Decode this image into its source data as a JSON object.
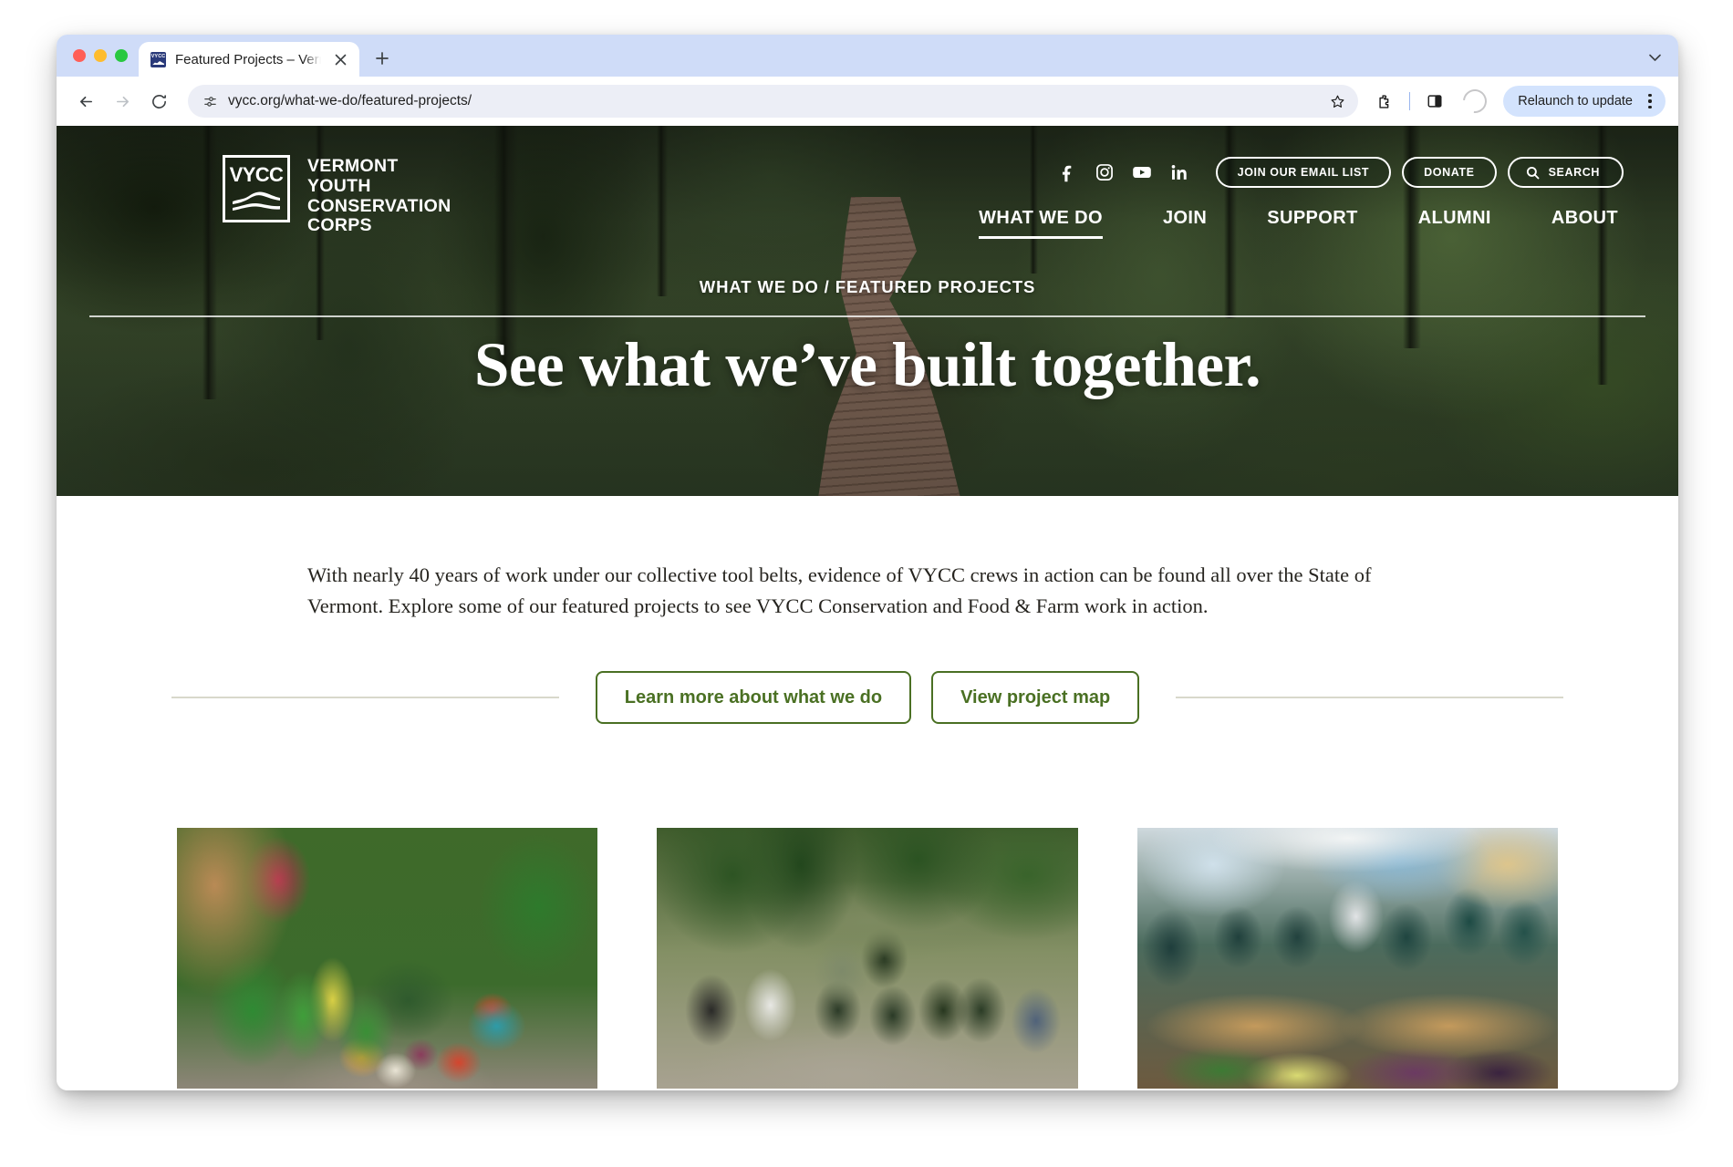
{
  "browser": {
    "tab": {
      "title": "Featured Projects – Vermont Youth Conservation Corps",
      "favicon_name": "vycc-favicon",
      "close_label": "×"
    },
    "new_tab_label": "+",
    "toolbar": {
      "back_label": "←",
      "forward_label": "→",
      "reload_label": "⟳",
      "url": "vycc.org/what-we-do/featured-projects/",
      "site_info_icon": "page-settings-icon",
      "bookmark_icon": "star-icon",
      "extensions_icon": "puzzle-icon",
      "side_panel_icon": "split-panel-icon",
      "profile_icon": "profile-avatar-icon",
      "relaunch_label": "Relaunch to update",
      "menu_icon": "kebab-menu-icon"
    }
  },
  "site": {
    "logo": {
      "mark_text": "VYCC",
      "words": "VERMONT\nYOUTH\nCONSERVATION\nCORPS",
      "word_lines": [
        "VERMONT",
        "YOUTH",
        "CONSERVATION",
        "CORPS"
      ]
    },
    "social": [
      {
        "name": "facebook-icon",
        "label": "f"
      },
      {
        "name": "instagram-icon",
        "label": ""
      },
      {
        "name": "youtube-icon",
        "label": ""
      },
      {
        "name": "linkedin-icon",
        "label": "in"
      }
    ],
    "utility_buttons": [
      {
        "label": "JOIN OUR EMAIL LIST",
        "name": "join-email-list-button"
      },
      {
        "label": "DONATE",
        "name": "donate-button"
      },
      {
        "label": "SEARCH",
        "name": "search-button"
      }
    ],
    "nav": [
      {
        "label": "WHAT WE DO",
        "active": true
      },
      {
        "label": "JOIN",
        "active": false
      },
      {
        "label": "SUPPORT",
        "active": false
      },
      {
        "label": "ALUMNI",
        "active": false
      },
      {
        "label": "ABOUT",
        "active": false
      }
    ],
    "hero": {
      "breadcrumb": "WHAT WE DO / FEATURED PROJECTS",
      "title": "See what we’ve built together.",
      "background": "forest boardwalk trail photo"
    },
    "intro": {
      "paragraph": "With nearly 40 years of work under our collective tool belts, evidence of VYCC crews in action can be found all over the State of Vermont. Explore some of our featured projects to see VYCC Conservation and Food & Farm work in action."
    },
    "cta_buttons": [
      {
        "label": "Learn more about what we do",
        "name": "learn-more-button"
      },
      {
        "label": "View project map",
        "name": "view-project-map-button"
      }
    ],
    "cards": [
      {
        "name": "project-card-harvest",
        "image_alt": "Freshly harvested vegetables in a bushel basket on a wooden table"
      },
      {
        "name": "project-card-crew",
        "image_alt": "VYCC crew members posing together at a garden worksite"
      },
      {
        "name": "project-card-produce-crates",
        "image_alt": "VYCC crew members holding wooden crates of cucumbers, squash and eggplant"
      }
    ]
  },
  "colors": {
    "brand_green": "#4a7023",
    "hero_overlay": "#0a0e08",
    "chrome_tabstrip": "#cfdcf8",
    "relaunch_pill": "#d3e3fd",
    "divider": "#d8d8cb"
  }
}
